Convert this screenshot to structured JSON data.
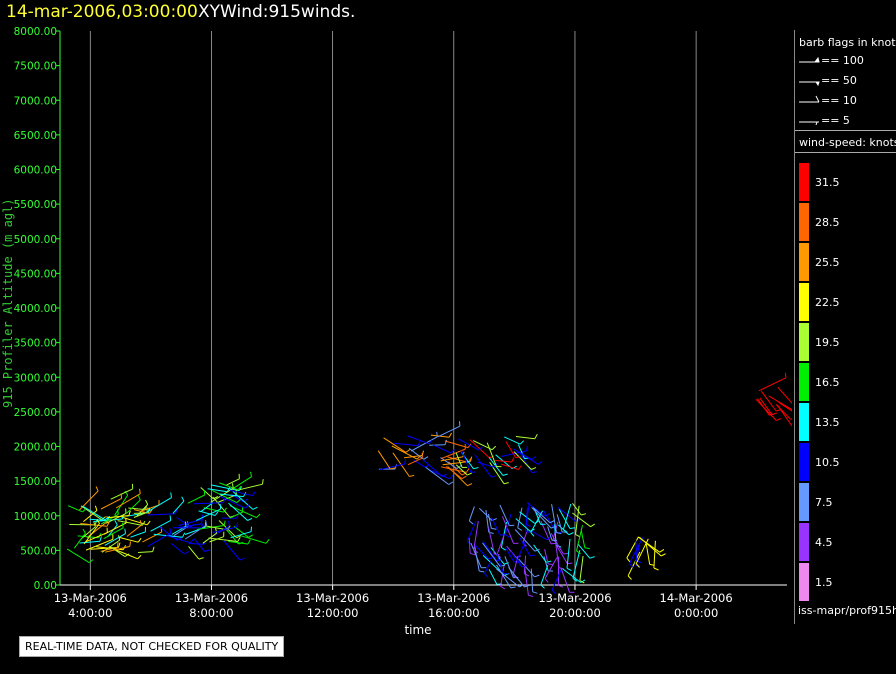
{
  "header": {
    "date": "14-mar-2006,03:00:00",
    "title": "XYWind:915winds."
  },
  "notice": "REAL-TIME DATA, NOT CHECKED FOR QUALITY",
  "source": "iss-mapr/prof915h",
  "legend": {
    "barb_title": "barb flags in knots",
    "barbs": [
      {
        "label": "== 100"
      },
      {
        "label": "== 50"
      },
      {
        "label": "== 10"
      },
      {
        "label": "== 5"
      }
    ],
    "speed_title": "wind-speed: knots",
    "colors": [
      {
        "label": "31.5",
        "color": "#ff0000"
      },
      {
        "label": "28.5",
        "color": "#ff6600"
      },
      {
        "label": "25.5",
        "color": "#ff9900"
      },
      {
        "label": "22.5",
        "color": "#ffff00"
      },
      {
        "label": "19.5",
        "color": "#aaff33"
      },
      {
        "label": "16.5",
        "color": "#00ee00"
      },
      {
        "label": "13.5",
        "color": "#00ffff"
      },
      {
        "label": "10.5",
        "color": "#0000ff"
      },
      {
        "label": "7.5",
        "color": "#6699ff"
      },
      {
        "label": "4.5",
        "color": "#9933ff"
      },
      {
        "label": "1.5",
        "color": "#ee88ee"
      }
    ]
  },
  "chart_data": {
    "type": "scatter",
    "ylabel": "915 Profiler Altitude (m agl)",
    "xlabel": "time",
    "ylim": [
      0,
      8000
    ],
    "yticks": [
      "0.00",
      "500.00",
      "1000.00",
      "1500.00",
      "2000.00",
      "2500.00",
      "3000.00",
      "3500.00",
      "4000.00",
      "4500.00",
      "5000.00",
      "5500.00",
      "6000.00",
      "6500.00",
      "7000.00",
      "7500.00",
      "8000.00"
    ],
    "xrange_hours": [
      "2006-03-13T03:00",
      "2006-03-14T03:00"
    ],
    "xticks": [
      {
        "line1": "13-Mar-2006",
        "line2": "4:00:00",
        "time": "2006-03-13T04:00"
      },
      {
        "line1": "13-Mar-2006",
        "line2": "8:00:00",
        "time": "2006-03-13T08:00"
      },
      {
        "line1": "13-Mar-2006",
        "line2": "12:00:00",
        "time": "2006-03-13T12:00"
      },
      {
        "line1": "13-Mar-2006",
        "line2": "16:00:00",
        "time": "2006-03-13T16:00"
      },
      {
        "line1": "13-Mar-2006",
        "line2": "20:00:00",
        "time": "2006-03-13T20:00"
      },
      {
        "line1": "14-Mar-2006",
        "line2": "0:00:00",
        "time": "2006-03-14T00:00"
      }
    ],
    "grid": "vertical",
    "clusters": [
      {
        "t0": "2006-03-13T03:00",
        "t1": "2006-03-13T05:45",
        "alt0": 450,
        "alt1": 1250,
        "speed_colors": [
          "#00ffff",
          "#aaff33",
          "#ffff00",
          "#00ee00",
          "#ff9900"
        ]
      },
      {
        "t0": "2006-03-13T05:50",
        "t1": "2006-03-13T07:10",
        "alt0": 550,
        "alt1": 1100,
        "speed_colors": [
          "#0000ff",
          "#00ffff",
          "#6699ff"
        ]
      },
      {
        "t0": "2006-03-13T07:10",
        "t1": "2006-03-13T09:00",
        "alt0": 500,
        "alt1": 1500,
        "speed_colors": [
          "#00ee00",
          "#aaff33",
          "#00ffff",
          "#0000ff"
        ]
      },
      {
        "t0": "2006-03-13T13:30",
        "t1": "2006-03-13T15:50",
        "alt0": 1650,
        "alt1": 2200,
        "speed_colors": [
          "#ff6600",
          "#0000ff",
          "#ff9900",
          "#6699ff"
        ]
      },
      {
        "t0": "2006-03-13T16:00",
        "t1": "2006-03-13T18:20",
        "alt0": 1700,
        "alt1": 2150,
        "speed_colors": [
          "#aaff33",
          "#00ffff",
          "#0000ff",
          "#ff0000"
        ]
      },
      {
        "t0": "2006-03-13T16:30",
        "t1": "2006-03-13T19:40",
        "alt0": 200,
        "alt1": 1200,
        "speed_colors": [
          "#9933ff",
          "#6699ff",
          "#00ffff",
          "#0000ff"
        ]
      },
      {
        "t0": "2006-03-13T19:50",
        "t1": "2006-03-13T20:20",
        "alt0": 350,
        "alt1": 1200,
        "speed_colors": [
          "#00ee00",
          "#00ffff",
          "#aaff33"
        ]
      },
      {
        "t0": "2006-03-13T22:00",
        "t1": "2006-03-13T22:40",
        "alt0": 450,
        "alt1": 700,
        "speed_colors": [
          "#0000ff",
          "#ffff00"
        ]
      },
      {
        "t0": "2006-03-14T01:40",
        "t1": "2006-03-14T02:45",
        "alt0": 2550,
        "alt1": 2900,
        "speed_colors": [
          "#ff0000"
        ]
      }
    ]
  }
}
